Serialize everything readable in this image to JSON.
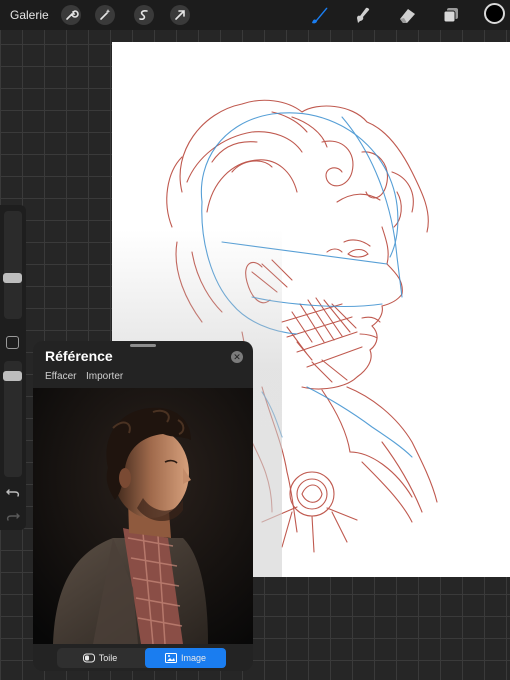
{
  "topbar": {
    "gallery_label": "Galerie",
    "left_tools": [
      "wrench-icon",
      "magic-wand-icon",
      "selection-icon",
      "transform-arrow-icon"
    ],
    "right_tools": [
      "brush-icon",
      "smudge-icon",
      "eraser-icon",
      "layers-icon"
    ],
    "active_tool": "brush-icon",
    "active_color": "#000000",
    "accent": "#1a7df0"
  },
  "sidebar": {
    "brush_size_slider": "size-slider",
    "opacity_slider": "opacity-slider",
    "icons": [
      "modify-square-icon",
      "undo-icon",
      "redo-icon"
    ]
  },
  "reference": {
    "title": "Référence",
    "actions": [
      "Effacer",
      "Importer"
    ],
    "tabs": [
      {
        "label": "Toile",
        "icon": "canvas-toggle-icon",
        "active": false
      },
      {
        "label": "Image",
        "icon": "image-icon",
        "active": true
      }
    ]
  }
}
